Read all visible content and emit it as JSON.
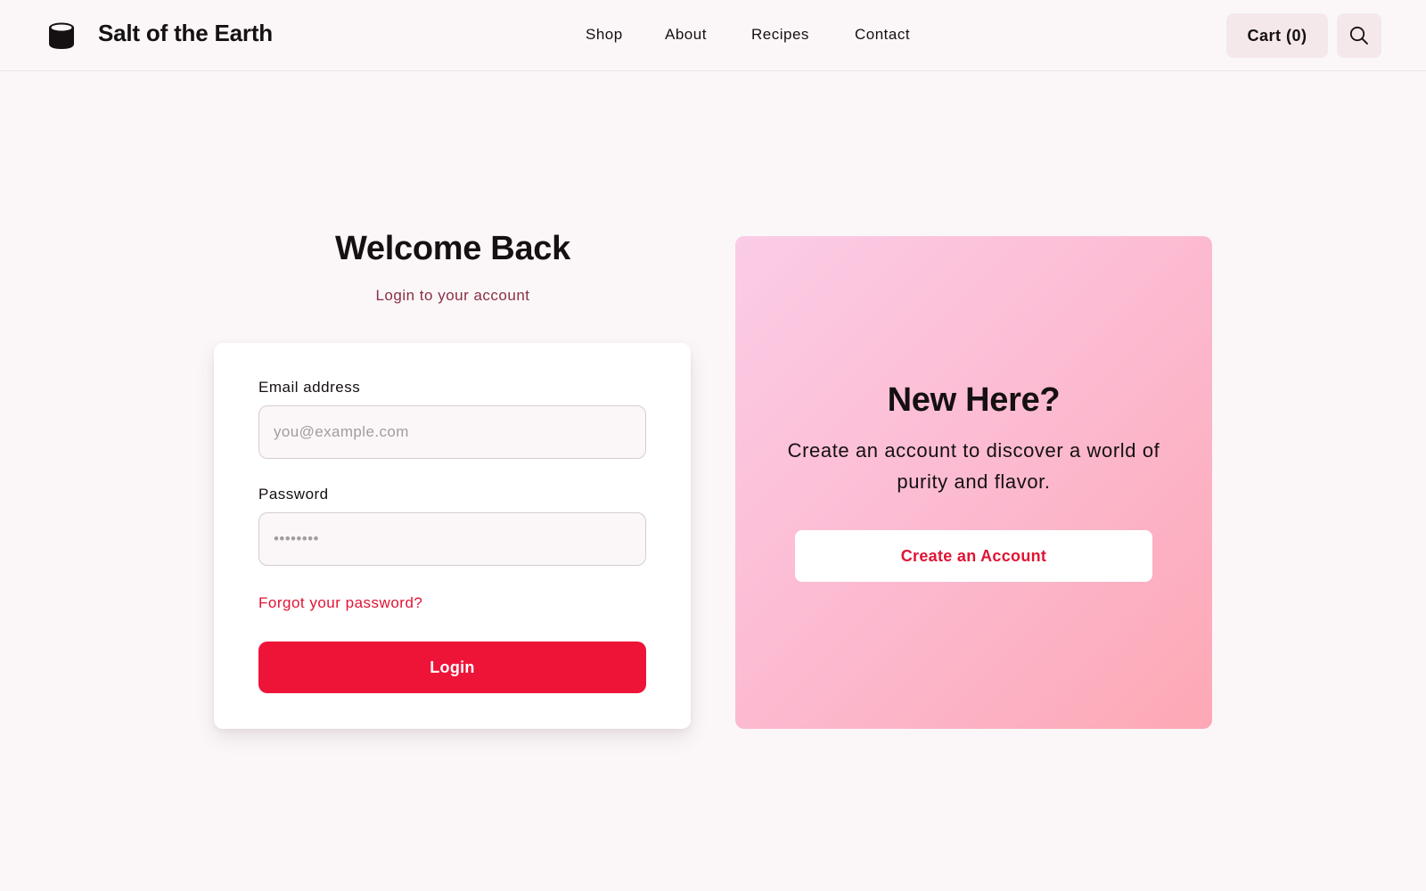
{
  "header": {
    "brand": "Salt of the Earth",
    "nav": [
      "Shop",
      "About",
      "Recipes",
      "Contact"
    ],
    "cart_label": "Cart (0)",
    "logo_icon": "salt-container-icon",
    "search_icon": "search-icon"
  },
  "login": {
    "title": "Welcome Back",
    "subtitle": "Login to your account",
    "email_label": "Email address",
    "email_placeholder": "you@example.com",
    "password_label": "Password",
    "password_placeholder": "••••••••",
    "forgot_link": "Forgot your password?",
    "submit_label": "Login"
  },
  "signup_promo": {
    "title": "New Here?",
    "text": "Create an account to discover a world of purity and flavor.",
    "button_label": "Create an Account"
  },
  "colors": {
    "accent_red": "#ee1438",
    "link_red": "#e01434",
    "subtitle": "#8a2f45",
    "page_bg": "#fbf7f8",
    "promo_gradient_start": "#fbcce6",
    "promo_gradient_end": "#fda8b5"
  }
}
